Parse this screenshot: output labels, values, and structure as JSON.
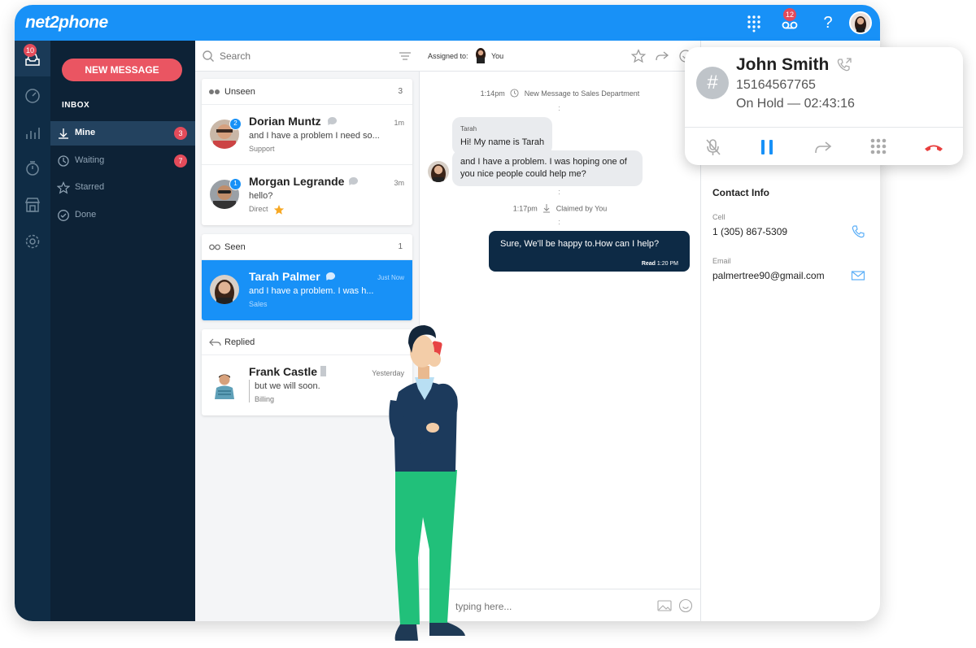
{
  "app": {
    "logo": "net2phone",
    "notifications_count": "12",
    "help": "?"
  },
  "rail": {
    "inbox_badge": "10"
  },
  "sidebar": {
    "new_message": "NEW MESSAGE",
    "inbox_label": "INBOX",
    "items": [
      {
        "label": "Mine",
        "count": "3"
      },
      {
        "label": "Waiting",
        "count": "7"
      },
      {
        "label": "Starred",
        "count": ""
      },
      {
        "label": "Done",
        "count": ""
      }
    ]
  },
  "list": {
    "search_placeholder": "Search",
    "groups": [
      {
        "title": "Unseen",
        "count": "3"
      },
      {
        "title": "Seen",
        "count": "1"
      },
      {
        "title": "Replied",
        "count": ""
      }
    ],
    "conversations": [
      {
        "name": "Dorian Muntz",
        "preview": "and I have a problem I need so...",
        "tag": "Support",
        "time": "1m",
        "unread": "2"
      },
      {
        "name": "Morgan Legrande",
        "preview": "hello?",
        "tag": "Direct",
        "time": "3m",
        "unread": "1"
      },
      {
        "name": "Tarah Palmer",
        "preview": "and I have a problem. I was h...",
        "tag": "Sales",
        "time": "Just Now",
        "unread": ""
      },
      {
        "name": "Frank Castle",
        "preview": "but we will soon.",
        "tag": "Billing",
        "time": "Yesterday",
        "unread": ""
      }
    ]
  },
  "chat": {
    "assigned_label": "Assigned to:",
    "assigned_to": "You",
    "sys1_time": "1:14pm",
    "sys1_text": "New Message to Sales Department",
    "sender": "Tarah",
    "msg1": "Hi! My name is Tarah",
    "msg2_line1": "and I have a problem. I was hoping one of",
    "msg2_line2": "you nice people could help me?",
    "sys2_time": "1:17pm",
    "sys2_text": "Claimed by You",
    "reply": "Sure, We'll be happy to.How can I help?",
    "reply_status": "Read",
    "reply_time": "1:20 PM",
    "typing_placeholder": "typing here..."
  },
  "contact": {
    "heading": "Contact Info",
    "cell_label": "Cell",
    "cell": "1 (305) 867-5309",
    "email_label": "Email",
    "email": "palmertree90@gmail.com"
  },
  "call": {
    "name": "John Smith",
    "number": "15164567765",
    "status": "On Hold — 02:43:16",
    "hash": "#"
  },
  "colors": {
    "primary": "#1891f7",
    "navy": "#0d2236",
    "accent_red": "#ea5562",
    "hangup": "#e8403f"
  }
}
